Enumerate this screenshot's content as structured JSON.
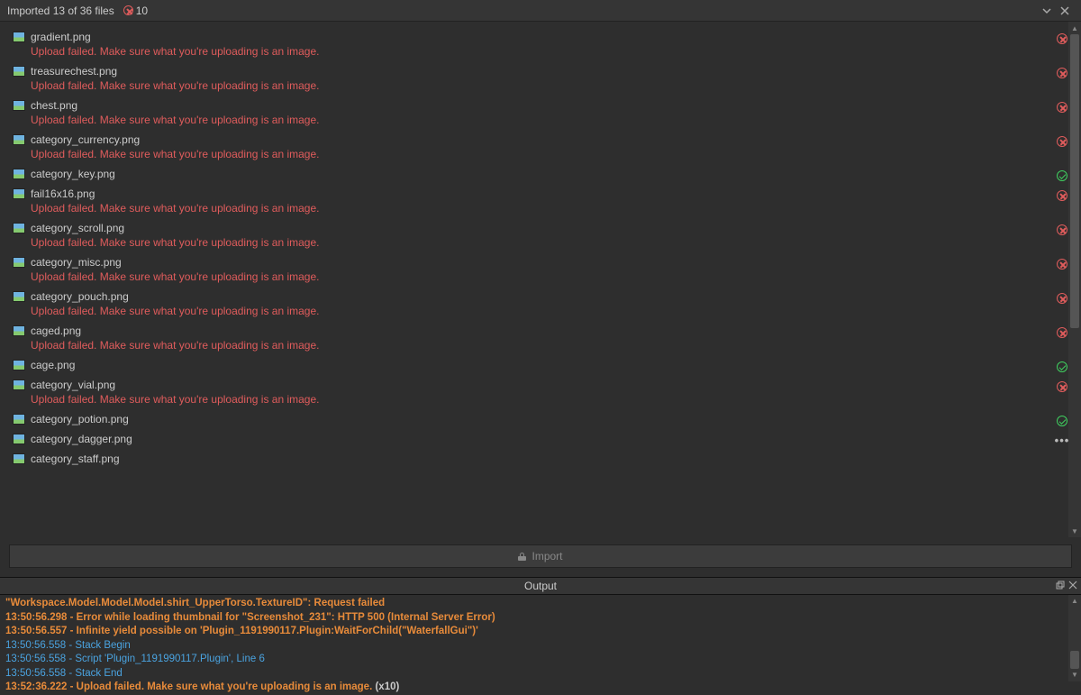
{
  "header": {
    "title": "Imported 13 of 36 files",
    "errorCount": "10"
  },
  "errorMessage": "Upload failed. Make sure what you're uploading is an image.",
  "files": [
    {
      "name": "gradient.png",
      "status": "error"
    },
    {
      "name": "treasurechest.png",
      "status": "error"
    },
    {
      "name": "chest.png",
      "status": "error"
    },
    {
      "name": "category_currency.png",
      "status": "error"
    },
    {
      "name": "category_key.png",
      "status": "ok"
    },
    {
      "name": "fail16x16.png",
      "status": "error"
    },
    {
      "name": "category_scroll.png",
      "status": "error"
    },
    {
      "name": "category_misc.png",
      "status": "error"
    },
    {
      "name": "category_pouch.png",
      "status": "error"
    },
    {
      "name": "caged.png",
      "status": "error"
    },
    {
      "name": "cage.png",
      "status": "ok"
    },
    {
      "name": "category_vial.png",
      "status": "error"
    },
    {
      "name": "category_potion.png",
      "status": "ok"
    },
    {
      "name": "category_dagger.png",
      "status": "pending"
    },
    {
      "name": "category_staff.png",
      "status": "none"
    }
  ],
  "importButton": "Import",
  "output": {
    "title": "Output",
    "lines": [
      {
        "style": "orange-bold",
        "text": "\"Workspace.Model.Model.Model.shirt_UpperTorso.TextureID\": Request failed"
      },
      {
        "style": "orange-bold",
        "text": "13:50:56.298 - Error while loading thumbnail for \"Screenshot_231\": HTTP 500 (Internal Server Error)"
      },
      {
        "style": "orange-bold",
        "text": " 13:50:56.557 - Infinite yield possible on 'Plugin_1191990117.Plugin:WaitForChild(\"WaterfallGui\")'"
      },
      {
        "style": "blue",
        "text": " 13:50:56.558 - Stack Begin"
      },
      {
        "style": "blue",
        "text": " 13:50:56.558 - Script 'Plugin_1191990117.Plugin', Line 6"
      },
      {
        "style": "blue",
        "text": " 13:50:56.558 - Stack End"
      },
      {
        "style": "orange-bold-mixed",
        "text": "13:52:36.222 - Upload failed. Make sure what you're uploading is an image.",
        "suffix": " (x10)"
      }
    ]
  }
}
